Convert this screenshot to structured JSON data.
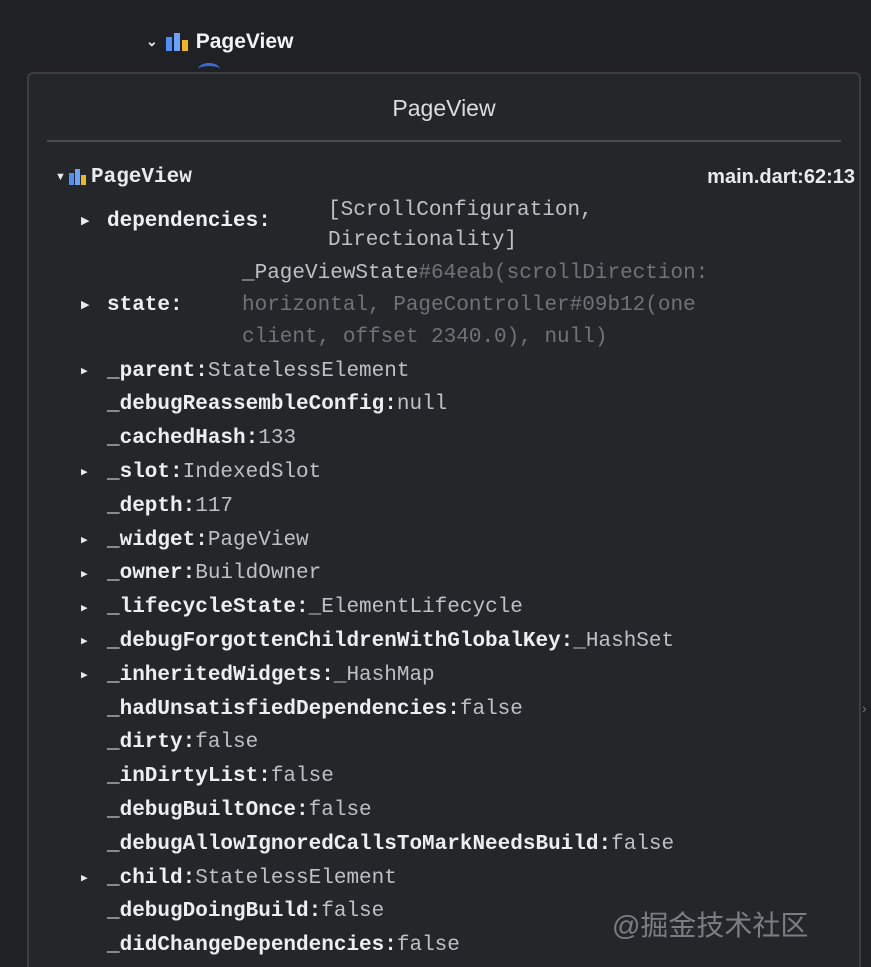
{
  "tree": {
    "node_label": "PageView"
  },
  "panel": {
    "title": "PageView",
    "root": {
      "name": "PageView",
      "location": "main.dart:62:13"
    },
    "dependencies": {
      "key": "dependencies:",
      "value_line1": "[ScrollConfiguration,",
      "value_line2": "Directionality]"
    },
    "state": {
      "key": "state:",
      "value_line1_strong": "_PageViewState",
      "value_line1_dim": "#64eab(scrollDirection:",
      "value_line2": "horizontal, PageController#09b12(one",
      "value_line3": "client, offset 2340.0), null)"
    },
    "props": [
      {
        "key": "_parent:",
        "value": "StatelessElement",
        "expandable": true
      },
      {
        "key": "_debugReassembleConfig:",
        "value": "null",
        "expandable": false
      },
      {
        "key": "_cachedHash:",
        "value": "133",
        "expandable": false
      },
      {
        "key": "_slot:",
        "value": "IndexedSlot",
        "expandable": true
      },
      {
        "key": "_depth:",
        "value": "117",
        "expandable": false
      },
      {
        "key": "_widget:",
        "value": "PageView",
        "expandable": true
      },
      {
        "key": "_owner:",
        "value": "BuildOwner",
        "expandable": true
      },
      {
        "key": "_lifecycleState:",
        "value": "_ElementLifecycle",
        "expandable": true
      },
      {
        "key": "_debugForgottenChildrenWithGlobalKey:",
        "value": "_HashSet",
        "expandable": true
      },
      {
        "key": "_inheritedWidgets:",
        "value": "_HashMap",
        "expandable": true
      },
      {
        "key": "_hadUnsatisfiedDependencies:",
        "value": "false",
        "expandable": false
      },
      {
        "key": "_dirty:",
        "value": "false",
        "expandable": false
      },
      {
        "key": "_inDirtyList:",
        "value": "false",
        "expandable": false
      },
      {
        "key": "_debugBuiltOnce:",
        "value": "false",
        "expandable": false
      },
      {
        "key": "_debugAllowIgnoredCallsToMarkNeedsBuild:",
        "value": "false",
        "expandable": false
      },
      {
        "key": "_child:",
        "value": "StatelessElement",
        "expandable": true
      },
      {
        "key": "_debugDoingBuild:",
        "value": "false",
        "expandable": false
      },
      {
        "key": "_didChangeDependencies:",
        "value": "false",
        "expandable": false
      }
    ]
  },
  "watermark": "@掘金技术社区",
  "colors": {
    "background": "#202124",
    "panel": "#24272a",
    "accent_blue": "#4f8ef5"
  }
}
